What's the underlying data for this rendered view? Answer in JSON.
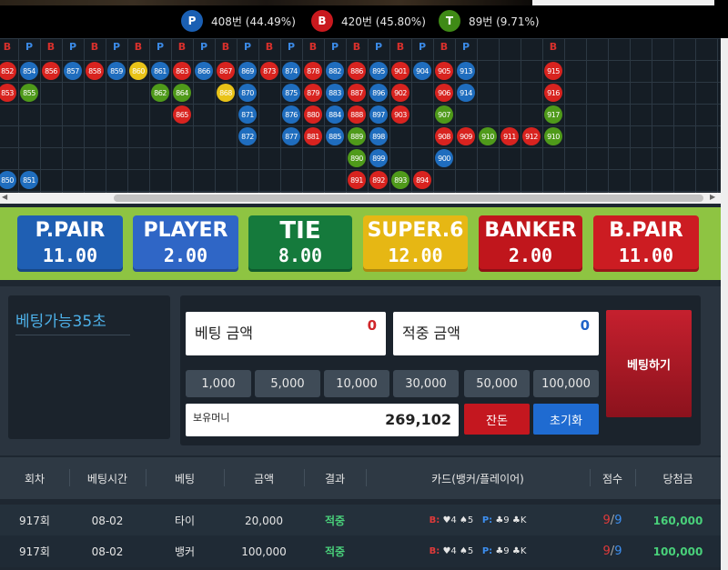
{
  "stats": {
    "player": {
      "symbol": "P",
      "text": "408번 (44.49%)",
      "color": "#1a5fb3"
    },
    "banker": {
      "symbol": "B",
      "text": "420번 (45.80%)",
      "color": "#c9191e"
    },
    "tie": {
      "symbol": "T",
      "text": "89번 (9.71%)",
      "color": "#3f8a16"
    }
  },
  "road": {
    "headers": [
      "B",
      "P",
      "B",
      "P",
      "B",
      "P",
      "B",
      "P",
      "B",
      "P",
      "B",
      "P",
      "B",
      "P",
      "B",
      "P",
      "B",
      "P",
      "B",
      "P",
      "B",
      "P",
      "",
      "",
      "",
      "B"
    ],
    "colors": {
      "B": "#d8231f",
      "P": "#1f6dbe",
      "T": "#4f9a1a",
      "Y": "#e9c318"
    },
    "balls": [
      {
        "col": 0,
        "row": 0,
        "num": "852",
        "c": "B"
      },
      {
        "col": 1,
        "row": 0,
        "num": "854",
        "c": "P"
      },
      {
        "col": 2,
        "row": 0,
        "num": "856",
        "c": "B"
      },
      {
        "col": 3,
        "row": 0,
        "num": "857",
        "c": "P"
      },
      {
        "col": 4,
        "row": 0,
        "num": "858",
        "c": "B"
      },
      {
        "col": 5,
        "row": 0,
        "num": "859",
        "c": "P"
      },
      {
        "col": 6,
        "row": 0,
        "num": "860",
        "c": "Y"
      },
      {
        "col": 7,
        "row": 0,
        "num": "861",
        "c": "P"
      },
      {
        "col": 8,
        "row": 0,
        "num": "863",
        "c": "B"
      },
      {
        "col": 9,
        "row": 0,
        "num": "866",
        "c": "P"
      },
      {
        "col": 10,
        "row": 0,
        "num": "867",
        "c": "B"
      },
      {
        "col": 11,
        "row": 0,
        "num": "869",
        "c": "P"
      },
      {
        "col": 12,
        "row": 0,
        "num": "873",
        "c": "B"
      },
      {
        "col": 13,
        "row": 0,
        "num": "874",
        "c": "P"
      },
      {
        "col": 14,
        "row": 0,
        "num": "878",
        "c": "B"
      },
      {
        "col": 15,
        "row": 0,
        "num": "882",
        "c": "P"
      },
      {
        "col": 16,
        "row": 0,
        "num": "886",
        "c": "B"
      },
      {
        "col": 17,
        "row": 0,
        "num": "895",
        "c": "P"
      },
      {
        "col": 18,
        "row": 0,
        "num": "901",
        "c": "B"
      },
      {
        "col": 19,
        "row": 0,
        "num": "904",
        "c": "P"
      },
      {
        "col": 20,
        "row": 0,
        "num": "905",
        "c": "B"
      },
      {
        "col": 21,
        "row": 0,
        "num": "913",
        "c": "P"
      },
      {
        "col": 25,
        "row": 0,
        "num": "915",
        "c": "B"
      },
      {
        "col": 0,
        "row": 1,
        "num": "853",
        "c": "B"
      },
      {
        "col": 1,
        "row": 1,
        "num": "855",
        "c": "T"
      },
      {
        "col": 7,
        "row": 1,
        "num": "862",
        "c": "T"
      },
      {
        "col": 8,
        "row": 1,
        "num": "864",
        "c": "T"
      },
      {
        "col": 10,
        "row": 1,
        "num": "868",
        "c": "Y"
      },
      {
        "col": 11,
        "row": 1,
        "num": "870",
        "c": "P"
      },
      {
        "col": 13,
        "row": 1,
        "num": "875",
        "c": "P"
      },
      {
        "col": 14,
        "row": 1,
        "num": "879",
        "c": "B"
      },
      {
        "col": 15,
        "row": 1,
        "num": "883",
        "c": "P"
      },
      {
        "col": 16,
        "row": 1,
        "num": "887",
        "c": "B"
      },
      {
        "col": 17,
        "row": 1,
        "num": "896",
        "c": "P"
      },
      {
        "col": 18,
        "row": 1,
        "num": "902",
        "c": "B"
      },
      {
        "col": 20,
        "row": 1,
        "num": "906",
        "c": "B"
      },
      {
        "col": 21,
        "row": 1,
        "num": "914",
        "c": "P"
      },
      {
        "col": 25,
        "row": 1,
        "num": "916",
        "c": "B"
      },
      {
        "col": 8,
        "row": 2,
        "num": "865",
        "c": "B"
      },
      {
        "col": 11,
        "row": 2,
        "num": "871",
        "c": "P"
      },
      {
        "col": 13,
        "row": 2,
        "num": "876",
        "c": "P"
      },
      {
        "col": 14,
        "row": 2,
        "num": "880",
        "c": "B"
      },
      {
        "col": 15,
        "row": 2,
        "num": "884",
        "c": "P"
      },
      {
        "col": 16,
        "row": 2,
        "num": "888",
        "c": "B"
      },
      {
        "col": 17,
        "row": 2,
        "num": "897",
        "c": "P"
      },
      {
        "col": 18,
        "row": 2,
        "num": "903",
        "c": "B"
      },
      {
        "col": 20,
        "row": 2,
        "num": "907",
        "c": "T"
      },
      {
        "col": 25,
        "row": 2,
        "num": "917",
        "c": "T"
      },
      {
        "col": 11,
        "row": 3,
        "num": "872",
        "c": "P"
      },
      {
        "col": 13,
        "row": 3,
        "num": "877",
        "c": "P"
      },
      {
        "col": 14,
        "row": 3,
        "num": "881",
        "c": "B"
      },
      {
        "col": 15,
        "row": 3,
        "num": "885",
        "c": "P"
      },
      {
        "col": 16,
        "row": 3,
        "num": "889",
        "c": "T"
      },
      {
        "col": 17,
        "row": 3,
        "num": "898",
        "c": "P"
      },
      {
        "col": 20,
        "row": 3,
        "num": "908",
        "c": "B"
      },
      {
        "col": 21,
        "row": 3,
        "num": "909",
        "c": "B"
      },
      {
        "col": 22,
        "row": 3,
        "num": "910",
        "c": "T"
      },
      {
        "col": 23,
        "row": 3,
        "num": "911",
        "c": "B"
      },
      {
        "col": 24,
        "row": 3,
        "num": "912",
        "c": "B"
      },
      {
        "col": 25,
        "row": 3,
        "num": "910",
        "c": "T"
      },
      {
        "col": 16,
        "row": 4,
        "num": "890",
        "c": "T"
      },
      {
        "col": 17,
        "row": 4,
        "num": "899",
        "c": "P"
      },
      {
        "col": 20,
        "row": 4,
        "num": "900",
        "c": "P"
      },
      {
        "col": 0,
        "row": 5,
        "num": "850",
        "c": "P"
      },
      {
        "col": 1,
        "row": 5,
        "num": "851",
        "c": "P"
      },
      {
        "col": 16,
        "row": 5,
        "num": "891",
        "c": "B"
      },
      {
        "col": 17,
        "row": 5,
        "num": "892",
        "c": "B"
      },
      {
        "col": 18,
        "row": 5,
        "num": "893",
        "c": "T"
      },
      {
        "col": 19,
        "row": 5,
        "num": "894",
        "c": "B"
      }
    ]
  },
  "bets": [
    {
      "name": "P.PAIR",
      "odds": "11.00",
      "color": "#1f5fb3"
    },
    {
      "name": "PLAYER",
      "odds": "2.00",
      "color": "#2f66c6"
    },
    {
      "name": "TIE",
      "odds": "8.00",
      "color": "#157a3c"
    },
    {
      "name": "SUPER.6",
      "odds": "12.00",
      "color": "#e6b714"
    },
    {
      "name": "BANKER",
      "odds": "2.00",
      "color": "#c0161c"
    },
    {
      "name": "B.PAIR",
      "odds": "11.00",
      "color": "#cc1c22"
    }
  ],
  "timer": {
    "text": "베팅가능35초"
  },
  "bet_amount": {
    "label": "베팅 금액",
    "value": "0"
  },
  "win_amount": {
    "label": "적중 금액",
    "value": "0"
  },
  "chips": [
    "1,000",
    "5,000",
    "10,000",
    "30,000",
    "50,000",
    "100,000"
  ],
  "money": {
    "label": "보유머니",
    "value": "269,102"
  },
  "buttons": {
    "change": "잔돈",
    "reset": "초기화",
    "bet": "베팅하기"
  },
  "history": {
    "headers": [
      "회차",
      "베팅시간",
      "베팅",
      "금액",
      "결과",
      "카드(뱅커/플레이어)",
      "점수",
      "당첨금"
    ],
    "rows": [
      {
        "round": "917회",
        "time": "08-02",
        "bet": "타이",
        "amount": "20,000",
        "result": "적중",
        "banker_label": "B:",
        "banker_cards": "♥4 ♠5",
        "player_label": "P:",
        "player_cards": "♣9 ♣K",
        "score_b": "9",
        "score_p": "9",
        "payout": "160,000"
      },
      {
        "round": "917회",
        "time": "08-02",
        "bet": "뱅커",
        "amount": "100,000",
        "result": "적중",
        "banker_label": "B:",
        "banker_cards": "♥4 ♠5",
        "player_label": "P:",
        "player_cards": "♣9 ♣K",
        "score_b": "9",
        "score_p": "9",
        "payout": "100,000"
      }
    ]
  }
}
